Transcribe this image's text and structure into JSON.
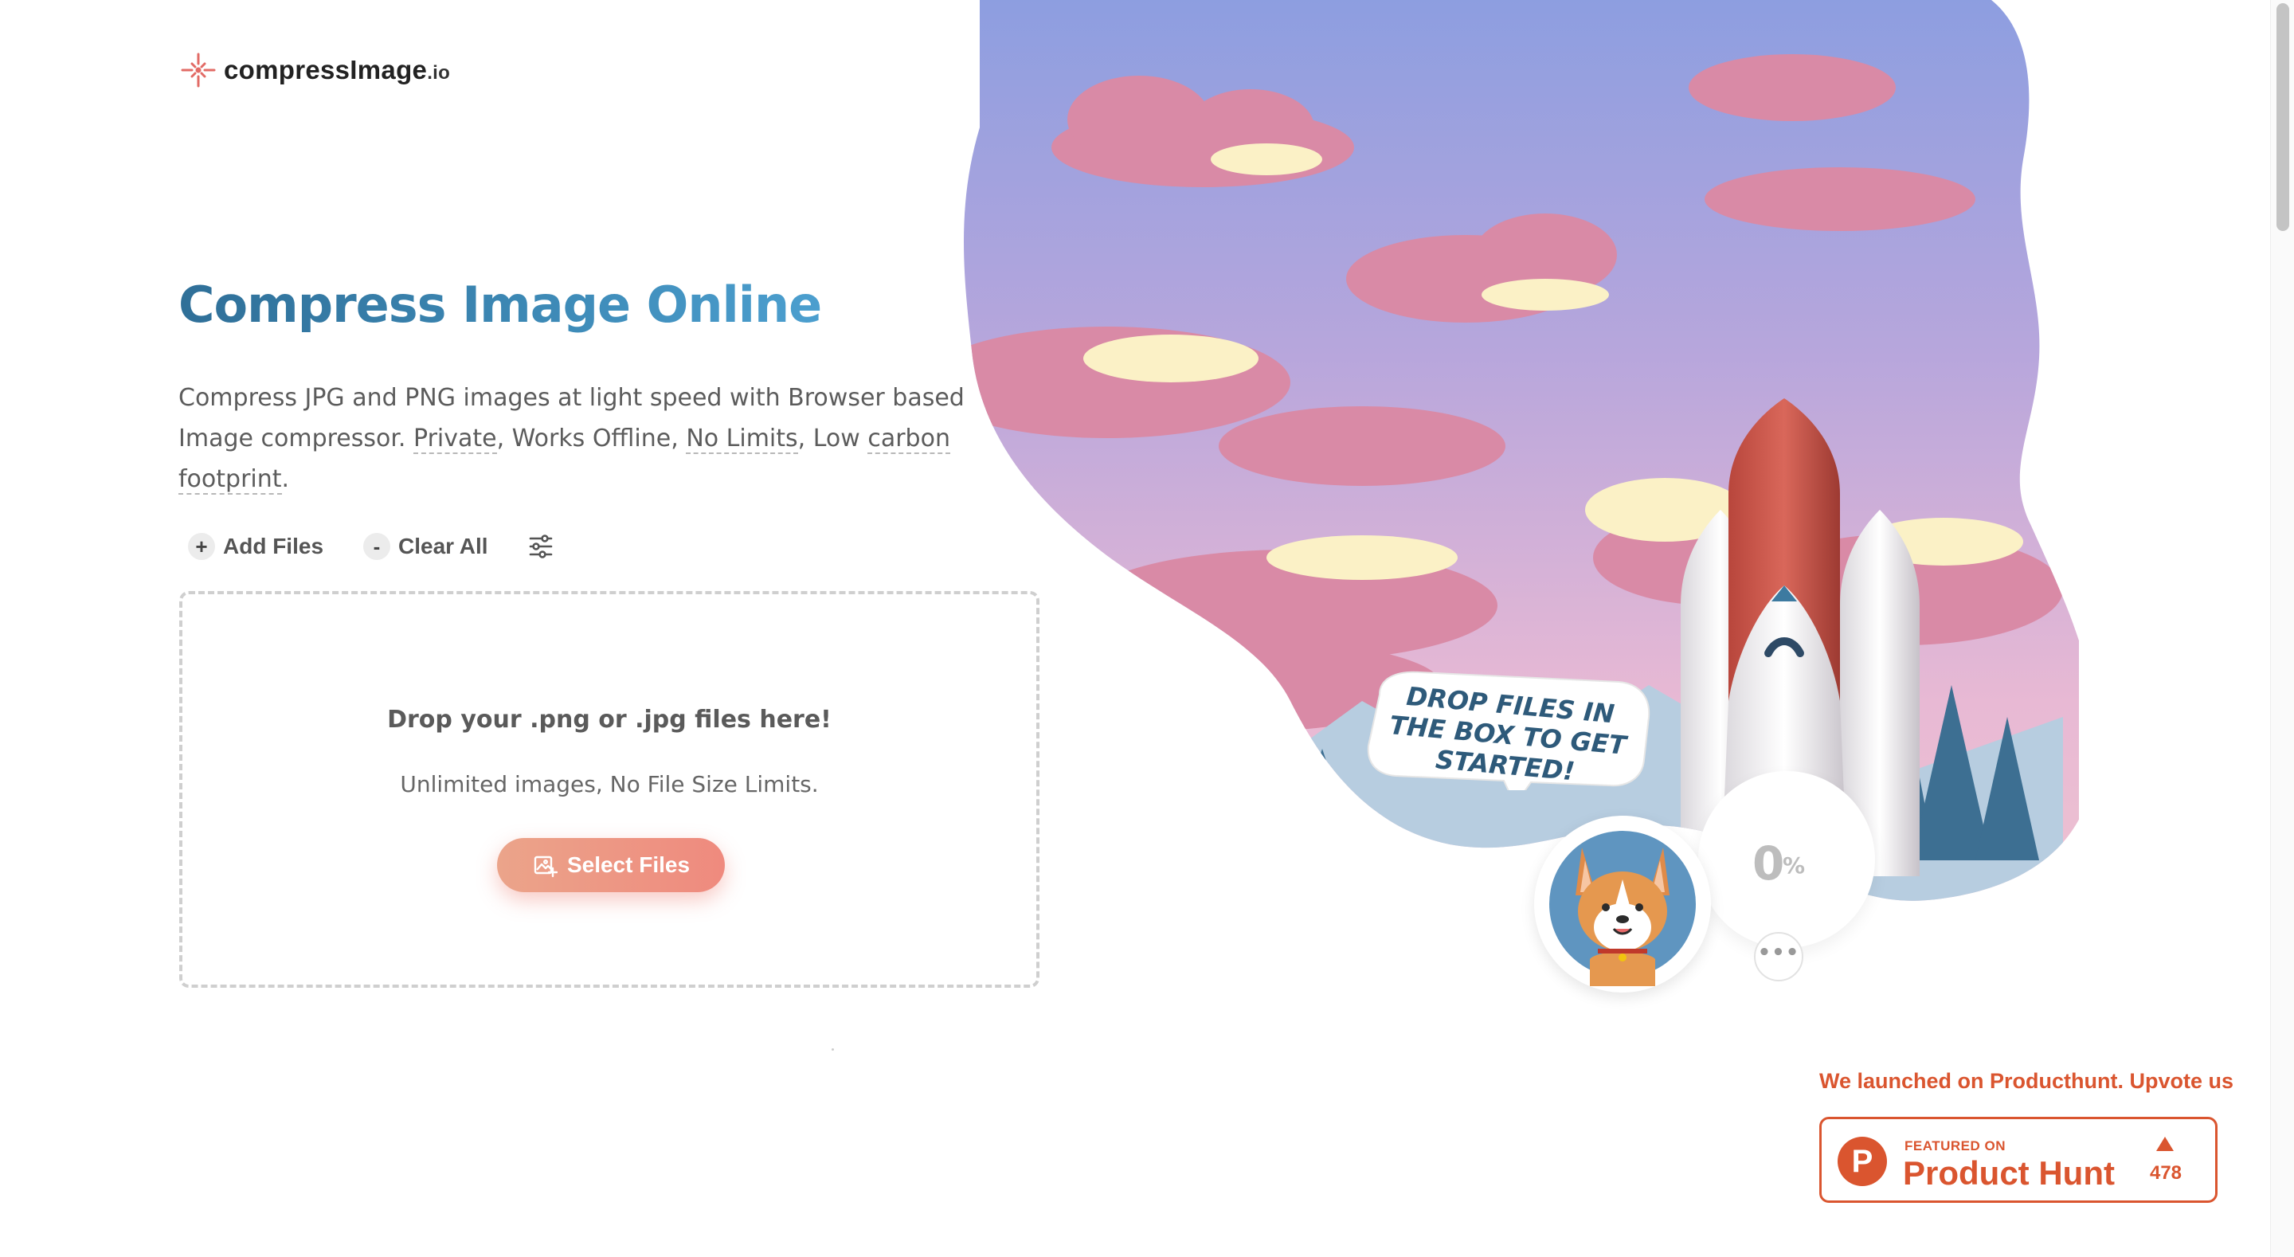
{
  "logo": {
    "name": "compressImage",
    "tld": ".io"
  },
  "hero": {
    "title": "Compress Image Online",
    "subtitle_part1": "Compress JPG and PNG images at light speed with Browser based Image compressor. ",
    "link_private": "Private",
    "subtitle_part2": ", Works Offline, ",
    "link_nolimits": "No Limits",
    "subtitle_part3": ", Low ",
    "link_carbon": "carbon footprint",
    "subtitle_part4": "."
  },
  "toolbar": {
    "add_icon": "+",
    "add_label": "Add Files",
    "clear_icon": "-",
    "clear_label": "Clear All",
    "settings_icon": "sliders-icon"
  },
  "dropzone": {
    "title": "Drop your .png or .jpg files here!",
    "subtitle": "Unlimited images, No File Size Limits.",
    "button_label": "Select Files"
  },
  "illustration": {
    "bubble_text": "Drop files in the box to get started!",
    "progress_value": "0",
    "progress_unit": "%",
    "more_label": "•••"
  },
  "producthunt": {
    "announcement": "We launched on Producthunt. Upvote us",
    "badge_small": "FEATURED ON",
    "badge_big": "Product Hunt",
    "logo_letter": "P",
    "votes": "478"
  },
  "colors": {
    "accent_blue": "#3e8bb8",
    "accent_coral": "#ef8a7e",
    "producthunt": "#da552f"
  }
}
